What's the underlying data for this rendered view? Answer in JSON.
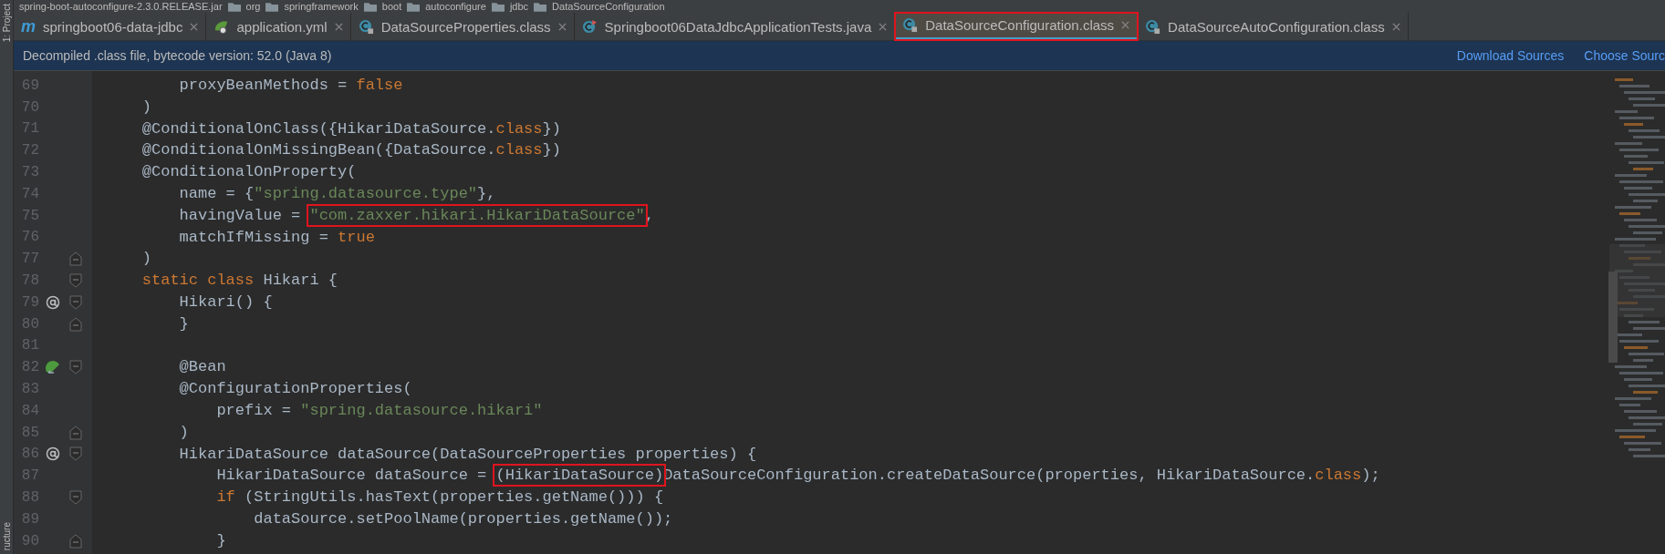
{
  "breadcrumb": [
    "spring-boot-autoconfigure-2.3.0.RELEASE.jar",
    "org",
    "springframework",
    "boot",
    "autoconfigure",
    "jdbc",
    "DataSourceConfiguration"
  ],
  "tool_stripe": {
    "top": "1: Project",
    "bottom": "ructure"
  },
  "tabs": [
    {
      "label": "springboot06-data-jdbc",
      "kind": "maven",
      "icon_label": "m",
      "selected": false,
      "annotated": false
    },
    {
      "label": "application.yml",
      "kind": "yaml",
      "selected": false,
      "annotated": false
    },
    {
      "label": "DataSourceProperties.class",
      "kind": "class",
      "selected": false,
      "annotated": false
    },
    {
      "label": "Springboot06DataJdbcApplicationTests.java",
      "kind": "java",
      "selected": false,
      "annotated": false
    },
    {
      "label": "DataSourceConfiguration.class",
      "kind": "class",
      "selected": true,
      "annotated": true
    },
    {
      "label": "DataSourceAutoConfiguration.class",
      "kind": "class",
      "selected": false,
      "annotated": false
    }
  ],
  "notice": {
    "text": "Decompiled .class file, bytecode version: 52.0 (Java 8)",
    "links": [
      "Download Sources",
      "Choose Sourc"
    ]
  },
  "lines": [
    {
      "number": "69",
      "tokens": [
        {
          "kind": "plain",
          "text": "        proxyBeanMethods = "
        },
        {
          "kind": "keyword",
          "text": "false"
        }
      ]
    },
    {
      "number": "70",
      "tokens": [
        {
          "kind": "plain",
          "text": "    )"
        }
      ]
    },
    {
      "number": "71",
      "tokens": [
        {
          "kind": "plain",
          "text": "    @ConditionalOnClass({HikariDataSource."
        },
        {
          "kind": "keyword",
          "text": "class"
        },
        {
          "kind": "plain",
          "text": "})"
        }
      ]
    },
    {
      "number": "72",
      "tokens": [
        {
          "kind": "plain",
          "text": "    @ConditionalOnMissingBean({DataSource."
        },
        {
          "kind": "keyword",
          "text": "class"
        },
        {
          "kind": "plain",
          "text": "})"
        }
      ]
    },
    {
      "number": "73",
      "tokens": [
        {
          "kind": "plain",
          "text": "    @ConditionalOnProperty("
        }
      ]
    },
    {
      "number": "74",
      "tokens": [
        {
          "kind": "plain",
          "text": "        name = {"
        },
        {
          "kind": "string",
          "text": "\"spring.datasource.type\""
        },
        {
          "kind": "plain",
          "text": "},"
        }
      ]
    },
    {
      "number": "75",
      "tokens": [
        {
          "kind": "plain",
          "text": "        havingValue = "
        },
        {
          "kind": "string",
          "text": "\"com.zaxxer.hikari.HikariDataSource\"",
          "boxed": true
        },
        {
          "kind": "plain",
          "text": ","
        }
      ]
    },
    {
      "number": "76",
      "tokens": [
        {
          "kind": "plain",
          "text": "        matchIfMissing = "
        },
        {
          "kind": "keyword",
          "text": "true"
        }
      ]
    },
    {
      "number": "77",
      "fold_close": true,
      "tokens": [
        {
          "kind": "plain",
          "text": "    )"
        }
      ]
    },
    {
      "number": "78",
      "fold_open": true,
      "tokens": [
        {
          "kind": "keyword",
          "text": "    static class"
        },
        {
          "kind": "plain",
          "text": " Hikari {"
        }
      ]
    },
    {
      "number": "79",
      "fold_open": true,
      "override": true,
      "tokens": [
        {
          "kind": "plain",
          "text": "        Hikari() {"
        }
      ]
    },
    {
      "number": "80",
      "fold_close": true,
      "tokens": [
        {
          "kind": "plain",
          "text": "        }"
        }
      ]
    },
    {
      "number": "81"
    },
    {
      "number": "82",
      "fold_open": true,
      "bean": true,
      "tokens": [
        {
          "kind": "plain",
          "text": "        @Bean"
        }
      ]
    },
    {
      "number": "83",
      "tokens": [
        {
          "kind": "plain",
          "text": "        @ConfigurationProperties("
        }
      ]
    },
    {
      "number": "84",
      "tokens": [
        {
          "kind": "plain",
          "text": "            prefix = "
        },
        {
          "kind": "string",
          "text": "\"spring.datasource.hikari\""
        }
      ]
    },
    {
      "number": "85",
      "fold_close": true,
      "tokens": [
        {
          "kind": "plain",
          "text": "        )"
        }
      ]
    },
    {
      "number": "86",
      "fold_open": true,
      "override": true,
      "tokens": [
        {
          "kind": "plain",
          "text": "        HikariDataSource dataSource(DataSourceProperties properties) {"
        }
      ]
    },
    {
      "number": "87",
      "tokens": [
        {
          "kind": "plain",
          "text": "            HikariDataSource dataSource = "
        },
        {
          "kind": "plain",
          "text": "(HikariDataSource)",
          "boxed": true
        },
        {
          "kind": "plain",
          "text": "DataSourceConfiguration.createDataSource(properties, HikariDataSource."
        },
        {
          "kind": "keyword",
          "text": "class"
        },
        {
          "kind": "plain",
          "text": ");"
        }
      ]
    },
    {
      "number": "88",
      "fold_open": true,
      "tokens": [
        {
          "kind": "keyword",
          "text": "            if"
        },
        {
          "kind": "plain",
          "text": " (StringUtils.hasText(properties.getName())) {"
        }
      ]
    },
    {
      "number": "89",
      "tokens": [
        {
          "kind": "plain",
          "text": "                dataSource.setPoolName(properties.getName());"
        }
      ]
    },
    {
      "number": "90",
      "fold_close": true,
      "tokens": [
        {
          "kind": "plain",
          "text": "            }"
        }
      ]
    }
  ]
}
